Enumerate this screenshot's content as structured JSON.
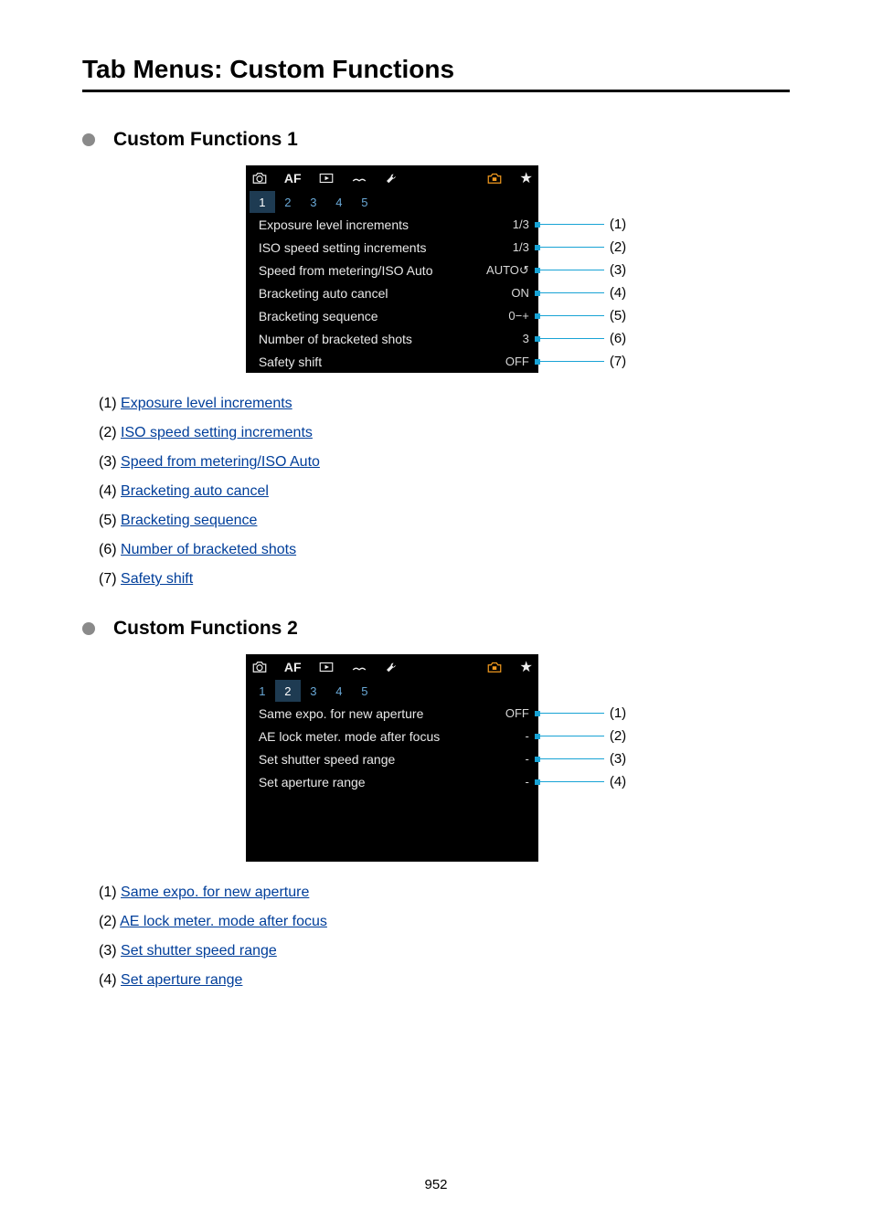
{
  "title": "Tab Menus: Custom Functions",
  "sections": [
    {
      "heading": "Custom Functions 1",
      "active_subtab": "1",
      "subtabs": [
        "1",
        "2",
        "3",
        "4",
        "5"
      ],
      "rows": [
        {
          "label": "Exposure level increments",
          "value": "1/3",
          "callout": "(1)"
        },
        {
          "label": "ISO speed setting increments",
          "value": "1/3",
          "callout": "(2)"
        },
        {
          "label": "Speed from metering/ISO Auto",
          "value": "AUTO↺",
          "callout": "(3)"
        },
        {
          "label": "Bracketing auto cancel",
          "value": "ON",
          "callout": "(4)"
        },
        {
          "label": "Bracketing sequence",
          "value": "0−+",
          "callout": "(5)"
        },
        {
          "label": "Number of bracketed shots",
          "value": "3",
          "callout": "(6)"
        },
        {
          "label": "Safety shift",
          "value": "OFF",
          "callout": "(7)"
        }
      ],
      "links": [
        {
          "num": "(1)",
          "text": "Exposure level increments"
        },
        {
          "num": "(2)",
          "text": "ISO speed setting increments"
        },
        {
          "num": "(3)",
          "text": "Speed from metering/ISO Auto"
        },
        {
          "num": "(4)",
          "text": "Bracketing auto cancel"
        },
        {
          "num": "(5)",
          "text": "Bracketing sequence"
        },
        {
          "num": "(6)",
          "text": "Number of bracketed shots"
        },
        {
          "num": "(7)",
          "text": "Safety shift"
        }
      ]
    },
    {
      "heading": "Custom Functions 2",
      "active_subtab": "2",
      "subtabs": [
        "1",
        "2",
        "3",
        "4",
        "5"
      ],
      "rows": [
        {
          "label": "Same expo. for new aperture",
          "value": "OFF",
          "callout": "(1)"
        },
        {
          "label": "AE lock meter. mode after focus",
          "value": "-",
          "callout": "(2)"
        },
        {
          "label": "Set shutter speed range",
          "value": "-",
          "callout": "(3)"
        },
        {
          "label": "Set aperture range",
          "value": "-",
          "callout": "(4)"
        }
      ],
      "links": [
        {
          "num": "(1)",
          "text": "Same expo. for new aperture"
        },
        {
          "num": "(2)",
          "text": "AE lock meter. mode after focus"
        },
        {
          "num": "(3)",
          "text": "Set shutter speed range"
        },
        {
          "num": "(4)",
          "text": "Set aperture range"
        }
      ]
    }
  ],
  "page_number": "952"
}
